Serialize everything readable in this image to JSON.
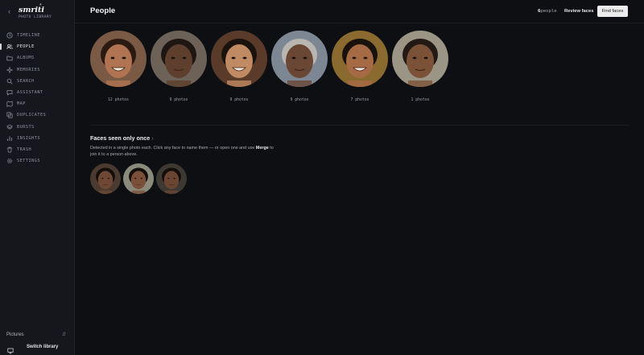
{
  "app": {
    "name": "smriti",
    "subtitle": "PHOTO LIBRARY",
    "back_icon": "chevron-left-icon",
    "spark": "*"
  },
  "sidebar": {
    "items": [
      {
        "label": "TIMELINE",
        "icon": "clock-icon"
      },
      {
        "label": "PEOPLE",
        "icon": "people-icon",
        "active": true
      },
      {
        "label": "ALBUMS",
        "icon": "folder-icon"
      },
      {
        "label": "MEMORIES",
        "icon": "sparkle-icon"
      },
      {
        "label": "SEARCH",
        "icon": "search-icon"
      },
      {
        "label": "ASSISTANT",
        "icon": "chat-icon"
      },
      {
        "label": "MAP",
        "icon": "map-icon"
      },
      {
        "label": "DUPLICATES",
        "icon": "duplicate-icon"
      },
      {
        "label": "BURSTS",
        "icon": "layers-icon"
      },
      {
        "label": "INSIGHTS",
        "icon": "bar-chart-icon"
      },
      {
        "label": "TRASH",
        "icon": "trash-icon"
      },
      {
        "label": "SETTINGS",
        "icon": "gear-icon"
      }
    ],
    "library_label": "Pictures",
    "library_caret": "⇵",
    "switch_label": "Switch library"
  },
  "header": {
    "title": "People",
    "count_number": "6",
    "count_unit": "people",
    "review_label": "Review faces",
    "find_label": "Find faces"
  },
  "people": [
    {
      "count": "12 photos",
      "skin": "#b07452",
      "hair": "#2a1a12",
      "bg": "#7a5a44"
    },
    {
      "count": "9 photos",
      "skin": "#5e3e2c",
      "hair": "#1e1612",
      "bg": "#6d6258"
    },
    {
      "count": "9 photos",
      "skin": "#c08a63",
      "hair": "#1a120d",
      "bg": "#5a3b2a"
    },
    {
      "count": "9 photos",
      "skin": "#6a4634",
      "hair": "#b9b6b2",
      "bg": "#7d8794"
    },
    {
      "count": "7 photos",
      "skin": "#a66a45",
      "hair": "#18110c",
      "bg": "#8a6a2e"
    },
    {
      "count": "1 photos",
      "skin": "#7b5238",
      "hair": "#231915",
      "bg": "#9a9584"
    }
  ],
  "once": {
    "title": "Faces seen only once",
    "arrow": "›",
    "desc_1": "Detected in a single photo each. Click any face to name them — or open one and use",
    "desc_bold": "Merge",
    "desc_2": "to join it to a person above.",
    "faces": [
      {
        "skin": "#6e4834",
        "bg": "#4a3a30"
      },
      {
        "skin": "#7a5038",
        "bg": "#8a8a7a"
      },
      {
        "skin": "#6a4532",
        "bg": "#3e3832"
      }
    ]
  }
}
